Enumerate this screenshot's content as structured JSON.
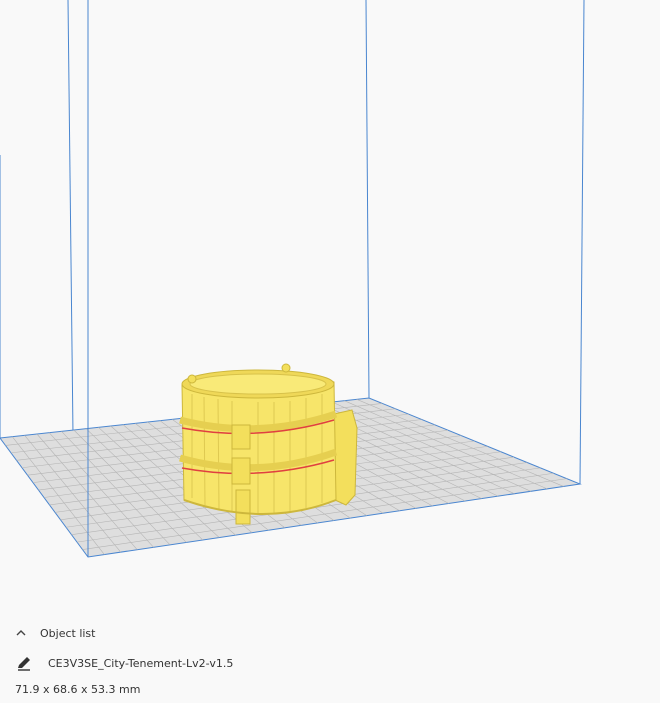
{
  "object_panel": {
    "toggle_label": "Object list",
    "toggle_icon": "chevron-up-icon",
    "edit_icon": "pencil-icon",
    "object_name": "CE3V3SE_City-Tenement-Lv2-v1.5",
    "dimensions": "71.9 x 68.6 x 53.3 mm"
  },
  "colors": {
    "background": "#f9f9f9",
    "build_volume_lines": "#4a86d0",
    "build_plate": "#dedede",
    "grid_lines": "#b5b5b5",
    "model": "#f7e56a",
    "model_shadow": "#cdb73c",
    "band_highlight": "#e04040"
  }
}
